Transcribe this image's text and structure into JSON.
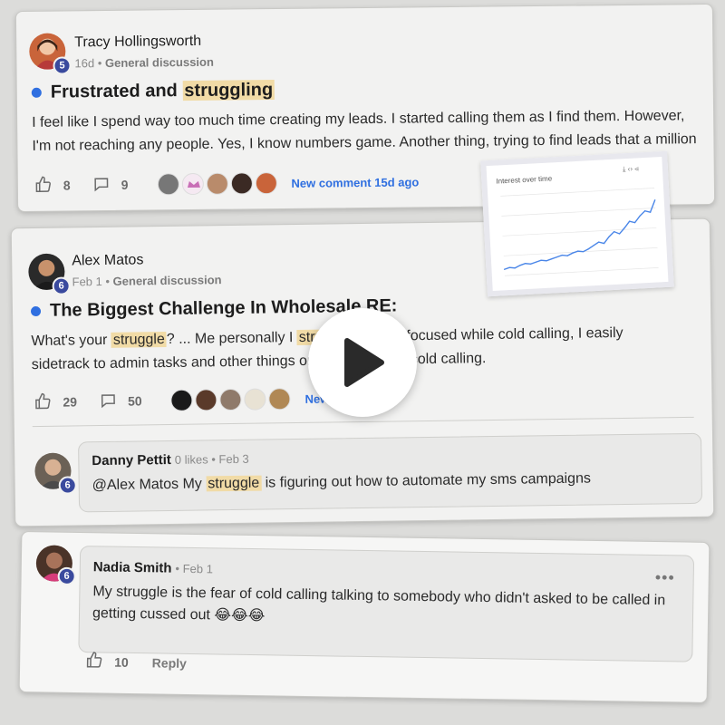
{
  "post1": {
    "author": "Tracy Hollingsworth",
    "level": "5",
    "age": "16d",
    "category": "General discussion",
    "title_pre": "Frustrated and ",
    "title_hl": "struggling",
    "body_line1": "I feel like I spend way too much time creating my leads. I started calling them as I find them. However,",
    "body_line2": "I'm not reaching any people. Yes, I know numbers game. Another thing, trying to find leads that a million",
    "likes": "8",
    "comments": "9",
    "new_comment": "New comment 15d ago"
  },
  "post2": {
    "author": "Alex Matos",
    "level": "6",
    "age": "Feb 1",
    "category": "General discussion",
    "title": "The Biggest Challenge In Wholesale RE:",
    "body_pre": "What's your ",
    "body_hl1": "struggle",
    "body_mid": "? ... Me personally I ",
    "body_hl2": "struggle",
    "body_tail": " staying focused while cold calling, I easily",
    "body_line2": "sidetrack to admin tasks and other things or scrolling while cold calling.",
    "likes": "29",
    "comments": "50",
    "new_comment": "New comment"
  },
  "comment1": {
    "author": "Danny Pettit",
    "level": "6",
    "meta": "0 likes • Feb 3",
    "text_pre": "@Alex Matos My ",
    "text_hl": "struggle",
    "text_post": " is figuring out how to automate my sms campaigns"
  },
  "comment2": {
    "author": "Nadia Smith",
    "level": "6",
    "meta": "• Feb 1",
    "line1": "My struggle is the fear of cold calling talking to somebody who didn't asked to be called in",
    "line2": "getting cussed out 😂😂😂",
    "likes": "10",
    "reply": "Reply",
    "more": "•••"
  },
  "chart_data": {
    "type": "line",
    "title": "Interest over time",
    "x": [
      0,
      1,
      2,
      3,
      4,
      5,
      6,
      7,
      8,
      9,
      10,
      11,
      12,
      13,
      14,
      15,
      16,
      17,
      18,
      19,
      20,
      21,
      22,
      23,
      24,
      25,
      26,
      27,
      28,
      29
    ],
    "values": [
      8,
      10,
      9,
      12,
      14,
      13,
      15,
      17,
      16,
      18,
      20,
      22,
      21,
      24,
      26,
      25,
      28,
      32,
      36,
      34,
      42,
      48,
      45,
      52,
      60,
      58,
      66,
      72,
      70,
      85
    ],
    "ylim": [
      0,
      100
    ],
    "grid": true,
    "legend": "none"
  },
  "colors": {
    "accent": "#2f6fe0",
    "highlight": "#f1dba6",
    "level_badge": "#3a4a9e",
    "chart_line": "#4a86e8"
  },
  "icons": {
    "like": "thumbs-up-icon",
    "comment": "comment-icon",
    "play": "play-icon",
    "more": "more-icon"
  }
}
